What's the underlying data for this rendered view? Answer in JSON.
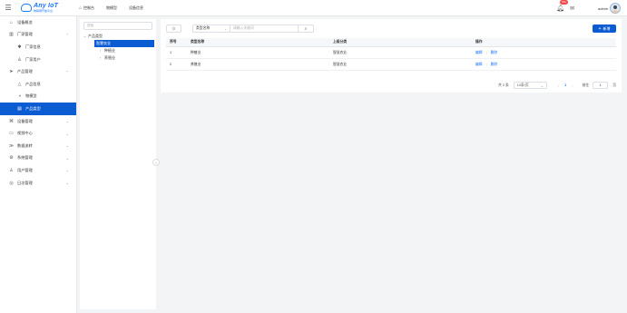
{
  "header": {
    "logo_main": "Any IoT",
    "logo_sub": "物联网开放平台",
    "nav": [
      {
        "icon": "home-icon",
        "label": "控制台"
      },
      {
        "icon": "",
        "label": "物模型"
      },
      {
        "icon": "",
        "label": "设备信息"
      }
    ],
    "notification_badge": "99+",
    "username": "admin"
  },
  "sidebar": {
    "items": [
      {
        "icon": "home-icon",
        "label": "设备概览",
        "level": 0,
        "chevron": ""
      },
      {
        "icon": "factory-icon",
        "label": "厂家管理",
        "level": 0,
        "chevron": "⌃"
      },
      {
        "icon": "gear-icon",
        "label": "厂家信息",
        "level": 1,
        "chevron": ""
      },
      {
        "icon": "user-icon",
        "label": "厂家用户",
        "level": 1,
        "chevron": ""
      },
      {
        "icon": "send-icon",
        "label": "产品管理",
        "level": 0,
        "chevron": "⌃"
      },
      {
        "icon": "triangle-icon",
        "label": "产品信息",
        "level": 1,
        "chevron": ""
      },
      {
        "icon": "half-circle-icon",
        "label": "物模型",
        "level": 1,
        "chevron": ""
      },
      {
        "icon": "document-icon",
        "label": "产品类型",
        "level": 1,
        "chevron": "",
        "active": true
      },
      {
        "icon": "device-icon",
        "label": "设备管理",
        "level": 0,
        "chevron": "⌄"
      },
      {
        "icon": "video-icon",
        "label": "视频中心",
        "level": 0,
        "chevron": "⌄"
      },
      {
        "icon": "forward-icon",
        "label": "数据流转",
        "level": 0,
        "chevron": "⌄"
      },
      {
        "icon": "settings-icon",
        "label": "系统管理",
        "level": 0,
        "chevron": "⌄"
      },
      {
        "icon": "user-icon",
        "label": "用户管理",
        "level": 0,
        "chevron": "⌄"
      },
      {
        "icon": "log-icon",
        "label": "日志管理",
        "level": 0,
        "chevron": "⌄"
      }
    ]
  },
  "tree": {
    "search_placeholder": "搜索",
    "root": "产品类型",
    "selected": "智慧农业",
    "children": [
      "种植业",
      "养殖业"
    ]
  },
  "toolbar": {
    "select_label": "类型名称",
    "search_placeholder": "请输入关键词",
    "add_label": "新增"
  },
  "table": {
    "headers": [
      "序号",
      "类型名称",
      "上级分类",
      "操作"
    ],
    "rows": [
      {
        "index": "1",
        "name": "种植业",
        "parent": "智慧农业",
        "edit": "编辑",
        "delete": "删除"
      },
      {
        "index": "2",
        "name": "养殖业",
        "parent": "智慧农业",
        "edit": "编辑",
        "delete": "删除"
      }
    ]
  },
  "pagination": {
    "total": "共 2 条",
    "page_size": "10条/页",
    "prev": "‹",
    "current": "1",
    "next": "›",
    "goto_label": "前往",
    "goto_value": "1",
    "page_unit": "页"
  }
}
